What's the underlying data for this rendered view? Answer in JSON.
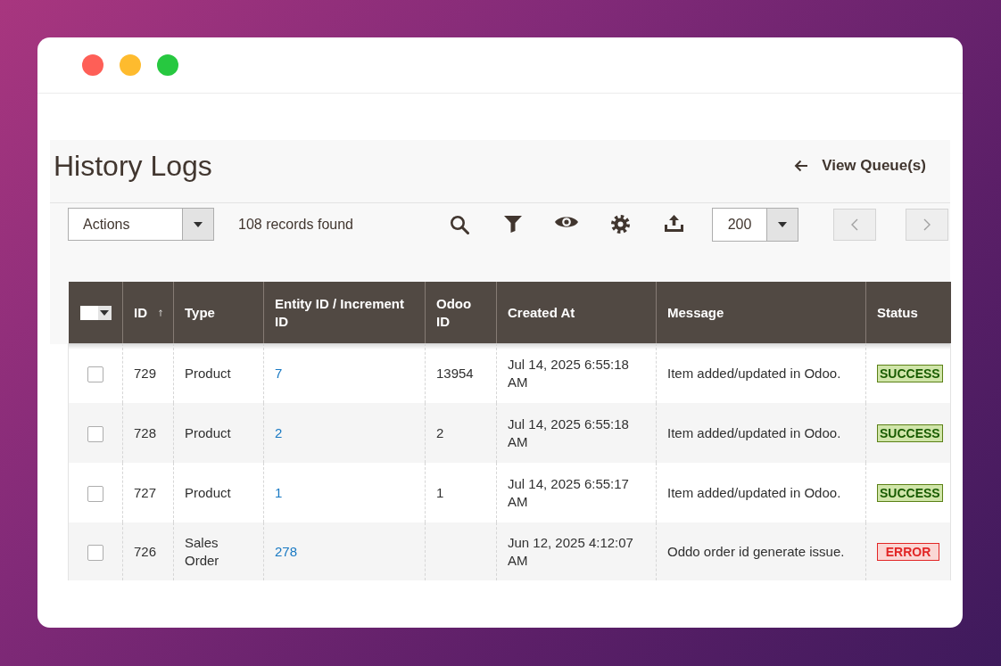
{
  "page": {
    "title": "History Logs",
    "back_link": "View Queue(s)"
  },
  "toolbar": {
    "actions": {
      "value": "Actions"
    },
    "records_found": "108 records found",
    "per_page": {
      "value": "200"
    }
  },
  "table": {
    "select_all": {
      "checked": false
    },
    "columns": [
      {
        "label": "ID",
        "sorted": true
      },
      {
        "label": "Type",
        "sorted": false
      },
      {
        "label": "Entity ID / Increment ID",
        "sorted": false
      },
      {
        "label": "Odoo ID",
        "sorted": false
      },
      {
        "label": "Created At",
        "sorted": false
      },
      {
        "label": "Message",
        "sorted": false
      },
      {
        "label": "Status",
        "sorted": false
      }
    ],
    "rows": [
      {
        "checked": false,
        "id": "729",
        "type": "Product",
        "entity_id": "7",
        "odoo_id": "13954",
        "created_at": "Jul 14, 2025 6:55:18 AM",
        "message": "Item added/updated in Odoo.",
        "status": {
          "label": "SUCCESS",
          "kind": "success"
        }
      },
      {
        "checked": false,
        "id": "728",
        "type": "Product",
        "entity_id": "2",
        "odoo_id": "2",
        "created_at": "Jul 14, 2025 6:55:18 AM",
        "message": "Item added/updated in Odoo.",
        "status": {
          "label": "SUCCESS",
          "kind": "success"
        }
      },
      {
        "checked": false,
        "id": "727",
        "type": "Product",
        "entity_id": "1",
        "odoo_id": "1",
        "created_at": "Jul 14, 2025 6:55:17 AM",
        "message": "Item added/updated in Odoo.",
        "status": {
          "label": "SUCCESS",
          "kind": "success"
        }
      },
      {
        "checked": false,
        "id": "726",
        "type": "Sales Order",
        "entity_id": "278",
        "created_at": "Jun 12, 2025 4:12:07 AM",
        "message": "Oddo order id generate issue.",
        "status": {
          "label": "ERROR",
          "kind": "error"
        }
      }
    ]
  }
}
